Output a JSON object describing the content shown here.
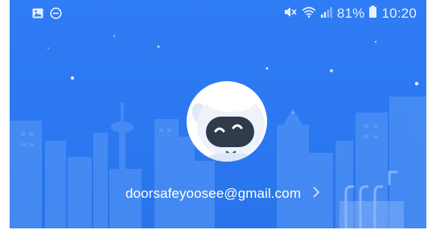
{
  "status_bar": {
    "left_icons": [
      "image-icon",
      "do-not-disturb-icon"
    ],
    "right_icons": [
      "mute-icon",
      "wifi-icon",
      "signal-icon",
      "battery-icon"
    ],
    "battery_percent": "81%",
    "time": "10:20"
  },
  "profile": {
    "email": "doorsafeyoosee@gmail.com",
    "avatar": "robot-mascot-icon"
  },
  "colors": {
    "header_blue": "#2f7cf4",
    "text_white": "#ffffff"
  }
}
